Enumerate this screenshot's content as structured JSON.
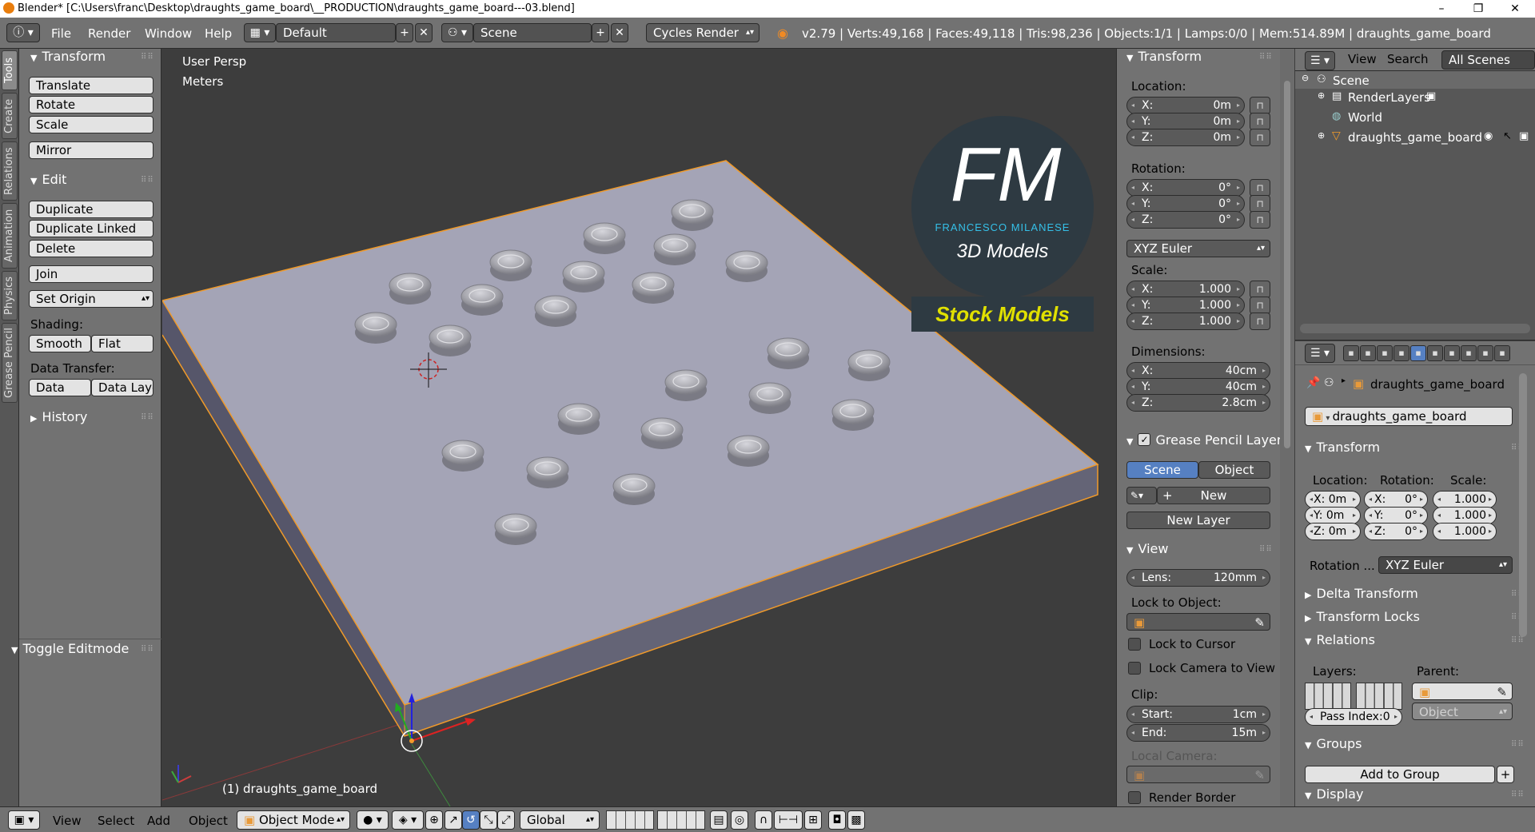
{
  "window": {
    "title": "Blender* [C:\\Users\\franc\\Desktop\\draughts_game_board\\__PRODUCTION\\draughts_game_board---03.blend]",
    "minimize": "–",
    "maximize": "❐",
    "close": "✕"
  },
  "topbar": {
    "menus": [
      "File",
      "Render",
      "Window",
      "Help"
    ],
    "layout": "Default",
    "scene": "Scene",
    "engine": "Cycles Render",
    "stats": "v2.79 | Verts:49,168 | Faces:49,118 | Tris:98,236 | Objects:1/1 | Lamps:0/0 | Mem:514.89M | draughts_game_board"
  },
  "tabs": [
    "Tools",
    "Create",
    "Relations",
    "Animation",
    "Physics",
    "Grease Pencil"
  ],
  "toolshelf": {
    "transform": {
      "title": "Transform",
      "buttons": [
        "Translate",
        "Rotate",
        "Scale",
        "Mirror"
      ]
    },
    "edit": {
      "title": "Edit",
      "buttons": [
        "Duplicate",
        "Duplicate Linked",
        "Delete",
        "Join"
      ],
      "set_origin": "Set Origin",
      "shading_label": "Shading:",
      "smooth": "Smooth",
      "flat": "Flat",
      "data_transfer_label": "Data Transfer:",
      "data": "Data",
      "data_layo": "Data Layo"
    },
    "history": "History",
    "toggle_editmode": "Toggle Editmode"
  },
  "viewport": {
    "view_name": "User Persp",
    "units": "Meters",
    "object_label": "(1) draughts_game_board",
    "logo": {
      "letters": "FM",
      "name": "FRANCESCO MILANESE",
      "sub": "3D Models",
      "banner": "Stock Models"
    }
  },
  "npanel": {
    "transform_title": "Transform",
    "location_label": "Location:",
    "rotation_label": "Rotation:",
    "scale_label": "Scale:",
    "dimensions_label": "Dimensions:",
    "location": [
      {
        "k": "X:",
        "v": "0m"
      },
      {
        "k": "Y:",
        "v": "0m"
      },
      {
        "k": "Z:",
        "v": "0m"
      }
    ],
    "rotation": [
      {
        "k": "X:",
        "v": "0°"
      },
      {
        "k": "Y:",
        "v": "0°"
      },
      {
        "k": "Z:",
        "v": "0°"
      }
    ],
    "rotation_mode": "XYZ Euler",
    "scale": [
      {
        "k": "X:",
        "v": "1.000"
      },
      {
        "k": "Y:",
        "v": "1.000"
      },
      {
        "k": "Z:",
        "v": "1.000"
      }
    ],
    "dimensions": [
      {
        "k": "X:",
        "v": "40cm"
      },
      {
        "k": "Y:",
        "v": "40cm"
      },
      {
        "k": "Z:",
        "v": "2.8cm"
      }
    ],
    "grease_title": "Grease Pencil Layer",
    "scene_btn": "Scene",
    "object_btn": "Object",
    "new_btn": "New",
    "new_layer_btn": "New Layer",
    "view_title": "View",
    "lens": {
      "k": "Lens:",
      "v": "120mm"
    },
    "lock_to_object": "Lock to Object:",
    "lock_to_cursor": "Lock to Cursor",
    "lock_camera": "Lock Camera to View",
    "clip_label": "Clip:",
    "clip_start": {
      "k": "Start:",
      "v": "1cm"
    },
    "clip_end": {
      "k": "End:",
      "v": "15m"
    },
    "local_camera": "Local Camera:",
    "render_border": "Render Border"
  },
  "outliner": {
    "view": "View",
    "search": "Search",
    "filter": "All Scenes",
    "items": [
      "Scene",
      "RenderLayers",
      "World",
      "draughts_game_board"
    ]
  },
  "properties": {
    "object_name_breadcrumb": "draughts_game_board",
    "object_name": "draughts_game_board",
    "transform_title": "Transform",
    "location_label": "Location:",
    "rotation_label": "Rotation:",
    "scale_label": "Scale:",
    "loc": [
      "X: 0m",
      "Y: 0m",
      "Z: 0m"
    ],
    "rot": [
      {
        "k": "X:",
        "v": "0°"
      },
      {
        "k": "Y:",
        "v": "0°"
      },
      {
        "k": "Z:",
        "v": "0°"
      }
    ],
    "scl": [
      "1.000",
      "1.000",
      "1.000"
    ],
    "rotation_mode_label": "Rotation ...",
    "rotation_mode": "XYZ Euler",
    "delta": "Delta Transform",
    "locks": "Transform Locks",
    "relations": "Relations",
    "layers_label": "Layers:",
    "parent_label": "Parent:",
    "parent_type": "Object",
    "pass_index": "Pass Index:0",
    "groups": "Groups",
    "add_to_group": "Add to Group",
    "display": "Display"
  },
  "bottombar": {
    "menus": [
      "View",
      "Select",
      "Add",
      "Object"
    ],
    "mode": "Object Mode",
    "orientation": "Global"
  }
}
